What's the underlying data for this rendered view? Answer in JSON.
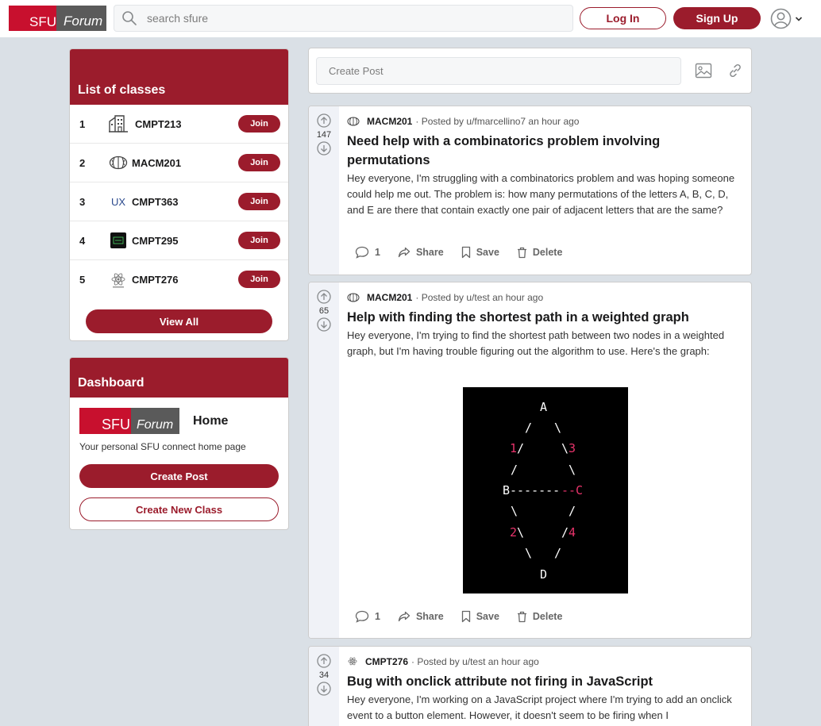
{
  "header": {
    "logo": {
      "left": "SFU",
      "right": "Forum"
    },
    "search_placeholder": "search sfure",
    "login_label": "Log In",
    "signup_label": "Sign Up",
    "user_icon": "user-circle-icon"
  },
  "classes": {
    "title": "List of classes",
    "items": [
      {
        "rank": "1",
        "name": "CMPT213",
        "icon": "building-icon",
        "join": "Join"
      },
      {
        "rank": "2",
        "name": "MACM201",
        "icon": "brain-icon",
        "join": "Join"
      },
      {
        "rank": "3",
        "name": "CMPT363",
        "icon_text": "UX",
        "join": "Join"
      },
      {
        "rank": "4",
        "name": "CMPT295",
        "icon": "chip-icon",
        "join": "Join"
      },
      {
        "rank": "5",
        "name": "CMPT276",
        "icon": "atom-icon",
        "join": "Join"
      }
    ],
    "view_all": "View All"
  },
  "dashboard": {
    "title": "Dashboard",
    "logo": {
      "left": "SFU",
      "right": "Forum"
    },
    "home": "Home",
    "description": "Your personal SFU connect home page",
    "create_post": "Create Post",
    "create_class": "Create New Class"
  },
  "create_post": {
    "placeholder": "Create Post"
  },
  "posts": [
    {
      "votes": "147",
      "class": "MACM201",
      "posted_by": "· Posted by u/fmarcellino7 an hour ago",
      "title": "Need help with a combinatorics problem involving permutations",
      "text": "Hey everyone, I'm struggling with a combinatorics problem and was hoping someone could help me out. The problem is: how many permutations of the letters A, B, C, D, and E are there that contain exactly one pair of adjacent letters that are the same?",
      "comments": "1",
      "share": "Share",
      "save": "Save",
      "delete": "Delete"
    },
    {
      "votes": "65",
      "class": "MACM201",
      "posted_by": "· Posted by u/test an hour ago",
      "title": "Help with finding the shortest path in a weighted graph",
      "text": "Hey everyone, I'm trying to find the shortest path between two nodes in a weighted graph, but I'm having trouble figuring out the algorithm to use. Here's the graph:",
      "graph": {
        "node_a": "A",
        "node_b": "B",
        "node_c": "C",
        "node_d": "D",
        "w1": "1",
        "w2": "2",
        "w3": "3",
        "w4": "4",
        "edge_bc_white": "-------",
        "edge_bc_pink": "--"
      },
      "comments": "1",
      "share": "Share",
      "save": "Save",
      "delete": "Delete"
    },
    {
      "votes": "34",
      "class": "CMPT276",
      "posted_by": "· Posted by u/test an hour ago",
      "title": "Bug with onclick attribute not firing in JavaScript",
      "text": "Hey everyone, I'm working on a JavaScript project where I'm trying to add an onclick event to a button element. However, it doesn't seem to be firing when I"
    }
  ],
  "colors": {
    "accent": "#9b1c2c",
    "logo_red": "#c8102e",
    "background": "#dae0e6"
  }
}
